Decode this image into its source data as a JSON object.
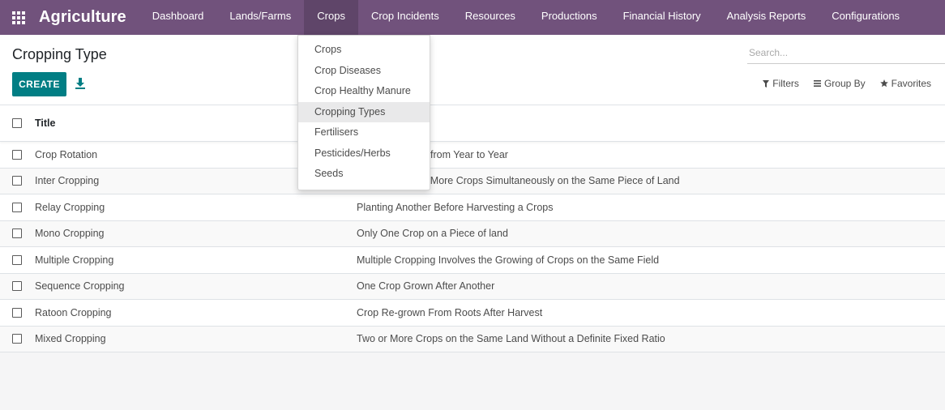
{
  "navbar": {
    "apps_icon": "grid-icon",
    "brand": "Agriculture",
    "menu": [
      {
        "label": "Dashboard"
      },
      {
        "label": "Lands/Farms"
      },
      {
        "label": "Crops"
      },
      {
        "label": "Crop Incidents"
      },
      {
        "label": "Resources"
      },
      {
        "label": "Productions"
      },
      {
        "label": "Financial History"
      },
      {
        "label": "Analysis Reports"
      },
      {
        "label": "Configurations"
      }
    ],
    "open_menu": "Crops"
  },
  "crops_dropdown": {
    "items": [
      {
        "label": "Crops"
      },
      {
        "label": "Crop Diseases"
      },
      {
        "label": "Crop Healthy Manure"
      },
      {
        "label": "Cropping Types"
      },
      {
        "label": "Fertilisers"
      },
      {
        "label": "Pesticides/Herbs"
      },
      {
        "label": "Seeds"
      }
    ],
    "highlighted": "Cropping Types"
  },
  "control_panel": {
    "title": "Cropping Type",
    "create_label": "CREATE",
    "download_icon": "download-icon",
    "search_placeholder": "Search...",
    "filters_label": "Filters",
    "group_by_label": "Group By",
    "favorites_label": "Favorites"
  },
  "list": {
    "header_title": "Title",
    "rows": [
      {
        "title": "Crop Rotation",
        "description": "Crops Changed from Year to Year"
      },
      {
        "title": "Inter Cropping",
        "description": "Growing Two or More Crops Simultaneously on the Same Piece of Land"
      },
      {
        "title": "Relay Cropping",
        "description": "Planting Another Before Harvesting a Crops"
      },
      {
        "title": "Mono Cropping",
        "description": "Only One Crop on a Piece of land"
      },
      {
        "title": "Multiple Cropping",
        "description": "Multiple Cropping Involves the Growing of Crops on the Same Field"
      },
      {
        "title": "Sequence Cropping",
        "description": "One Crop Grown After Another"
      },
      {
        "title": "Ratoon Cropping",
        "description": "Crop Re-grown From Roots After Harvest"
      },
      {
        "title": "Mixed Cropping",
        "description": "Two or More Crops on the Same Land Without a Definite Fixed Ratio"
      }
    ]
  },
  "colors": {
    "navbar": "#71527c",
    "primary": "#017e84"
  }
}
